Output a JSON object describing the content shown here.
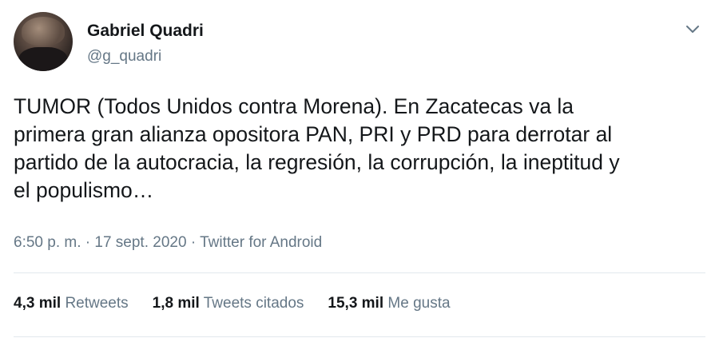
{
  "author": {
    "name": "Gabriel Quadri",
    "handle": "@g_quadri"
  },
  "tweet": {
    "text": "TUMOR (Todos Unidos contra Morena). En Zacatecas va la\nprimera gran alianza opositora PAN, PRI y PRD para derrotar al\npartido de la autocracia, la regresión, la corrupción, la ineptitud y\nel populismo…",
    "time": "6:50 p. m.",
    "separator1": "·",
    "date": "17 sept. 2020",
    "separator2": "·",
    "source": "Twitter for Android"
  },
  "stats": [
    {
      "count": "4,3 mil",
      "label": "Retweets"
    },
    {
      "count": "1,8 mil",
      "label": "Tweets citados"
    },
    {
      "count": "15,3 mil",
      "label": "Me gusta"
    }
  ],
  "icons": {
    "menu": "chevron-down-icon"
  },
  "colors": {
    "text": "#14171a",
    "secondary": "#657786",
    "divider": "#e1e8ed"
  }
}
